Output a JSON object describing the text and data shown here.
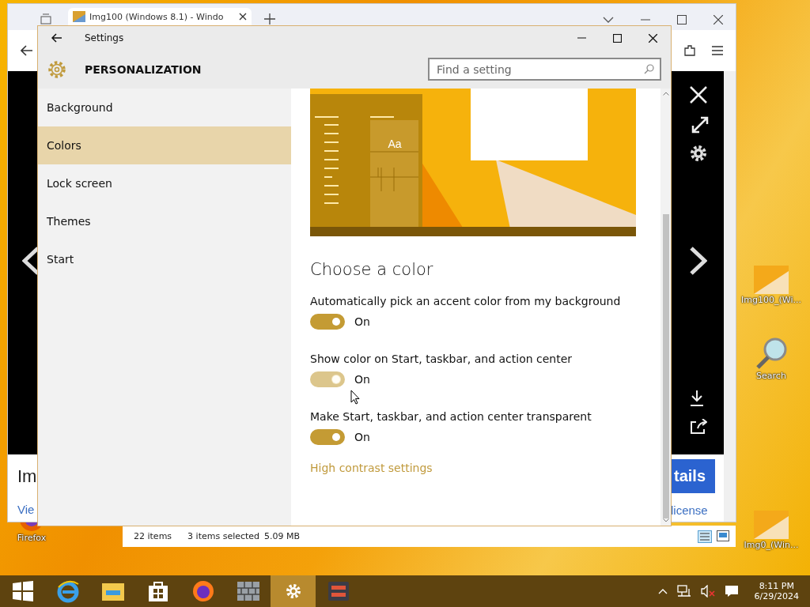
{
  "desktop": {
    "icons": [
      {
        "kind": "firefox",
        "label": "Firefox"
      },
      {
        "kind": "picture",
        "label": "Img100_(Wi..."
      },
      {
        "kind": "search",
        "label": "Search"
      },
      {
        "kind": "picture",
        "label": "Img0_(Win..."
      }
    ]
  },
  "browser": {
    "tab": {
      "title": "Img100 (Windows 8.1) - Windo"
    },
    "page": {
      "heading": "Im",
      "link": "Vie",
      "button": "tails",
      "license": "license"
    }
  },
  "explorer": {
    "count": "22 items",
    "selection": "3 items selected",
    "size": "5.09 MB"
  },
  "settings": {
    "title": "Settings",
    "section": "PERSONALIZATION",
    "search": {
      "placeholder": "Find a setting"
    },
    "nav": [
      {
        "label": "Background",
        "selected": false
      },
      {
        "label": "Colors",
        "selected": true
      },
      {
        "label": "Lock screen",
        "selected": false
      },
      {
        "label": "Themes",
        "selected": false
      },
      {
        "label": "Start",
        "selected": false
      }
    ],
    "preview_text": "Aa",
    "heading": "Choose a color",
    "options": [
      {
        "label": "Automatically pick an accent color from my background",
        "on": true,
        "state_text": "On",
        "hovered": false
      },
      {
        "label": "Show color on Start, taskbar, and action center",
        "on": true,
        "state_text": "On",
        "hovered": true
      },
      {
        "label": "Make Start, taskbar, and action center transparent",
        "on": true,
        "state_text": "On",
        "hovered": false
      }
    ],
    "link": "High contrast settings"
  },
  "taskbar": {
    "apps": [
      {
        "kind": "start",
        "selected": false
      },
      {
        "kind": "ie",
        "selected": false
      },
      {
        "kind": "folder",
        "selected": false
      },
      {
        "kind": "store",
        "selected": false
      },
      {
        "kind": "firefox",
        "selected": false
      },
      {
        "kind": "wall",
        "selected": false
      },
      {
        "kind": "gear",
        "selected": true
      },
      {
        "kind": "server",
        "selected": false
      }
    ],
    "time": "8:11 PM",
    "date": "6/29/2024"
  }
}
